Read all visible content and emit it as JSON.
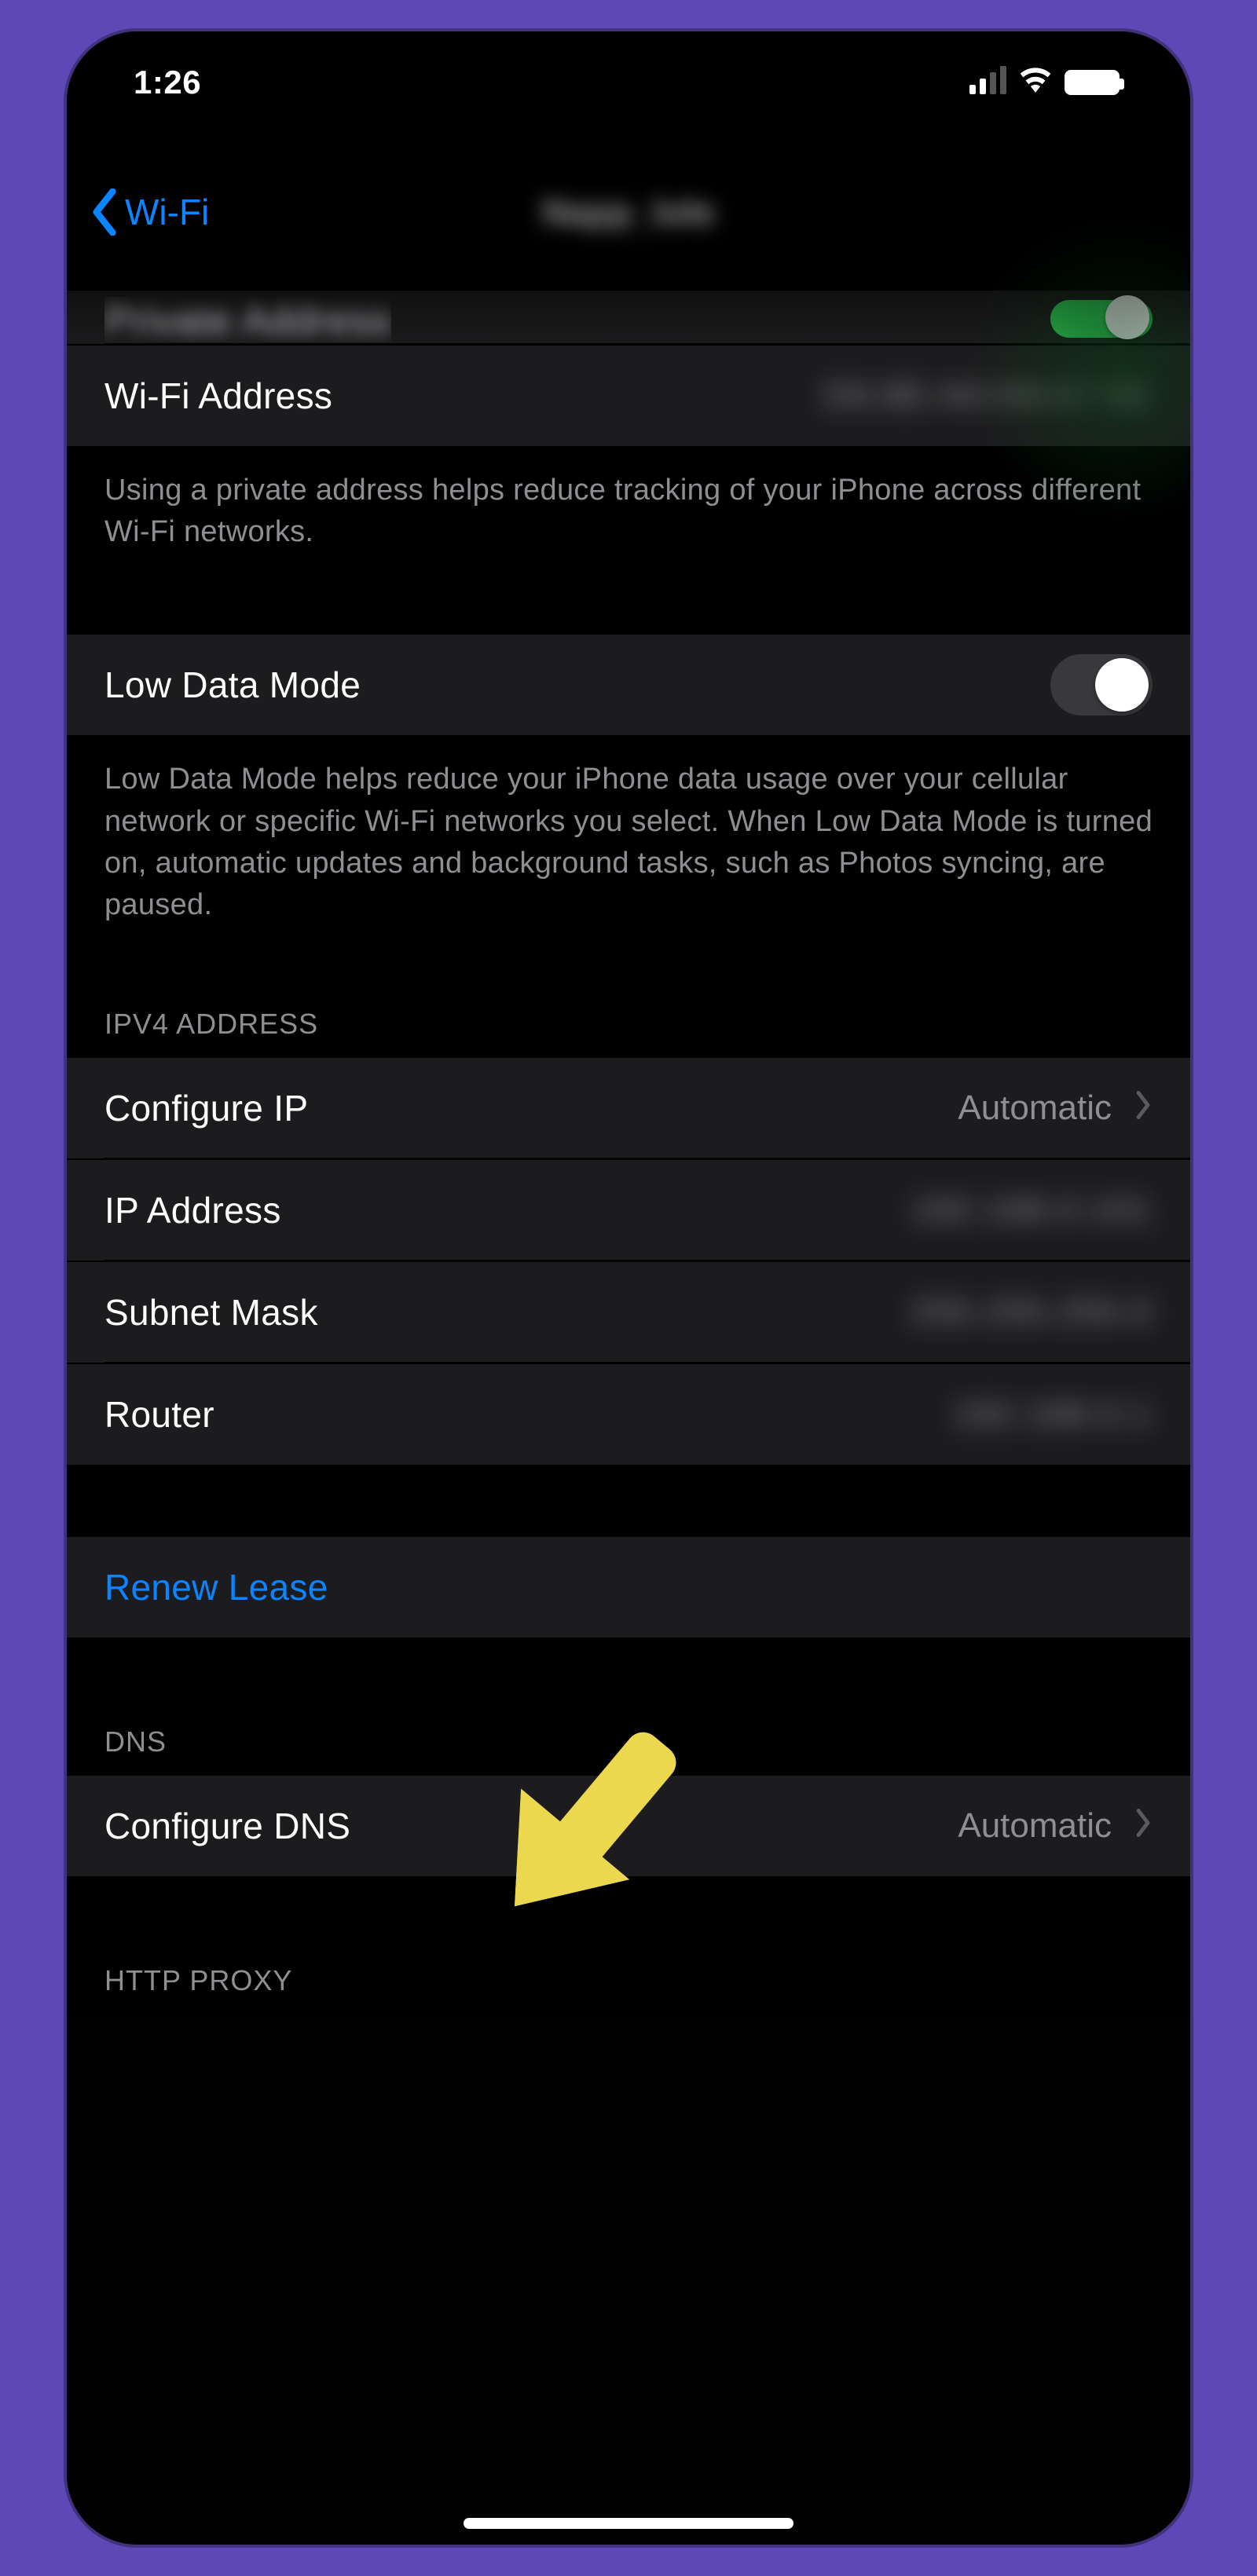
{
  "status": {
    "time": "1:26"
  },
  "nav": {
    "back_label": "Wi-Fi",
    "title": "Napp_lole"
  },
  "rows": {
    "private_address": {
      "label": "Private Address",
      "toggle": "on"
    },
    "wifi_address": {
      "label": "Wi-Fi Address",
      "value": "D6:8E:A0:D8:67:9E"
    },
    "low_data": {
      "label": "Low Data Mode",
      "toggle": "off"
    },
    "configure_ip": {
      "label": "Configure IP",
      "value": "Automatic"
    },
    "ip_address": {
      "label": "IP Address",
      "value": "192.168.0.101"
    },
    "subnet_mask": {
      "label": "Subnet Mask",
      "value": "255.255.255.0"
    },
    "router": {
      "label": "Router",
      "value": "192.168.0.1"
    },
    "renew_lease": {
      "label": "Renew Lease"
    },
    "configure_dns": {
      "label": "Configure DNS",
      "value": "Automatic"
    }
  },
  "footers": {
    "private_address": "Using a private address helps reduce tracking of your iPhone across different Wi-Fi networks.",
    "low_data": "Low Data Mode helps reduce your iPhone data usage over your cellular network or specific Wi-Fi networks you select. When Low Data Mode is turned on, automatic updates and background tasks, such as Photos syncing, are paused."
  },
  "headers": {
    "ipv4": "IPV4 ADDRESS",
    "dns": "DNS",
    "http_proxy": "HTTP PROXY"
  },
  "annotation": {
    "arrow_color": "#ebd84f"
  }
}
